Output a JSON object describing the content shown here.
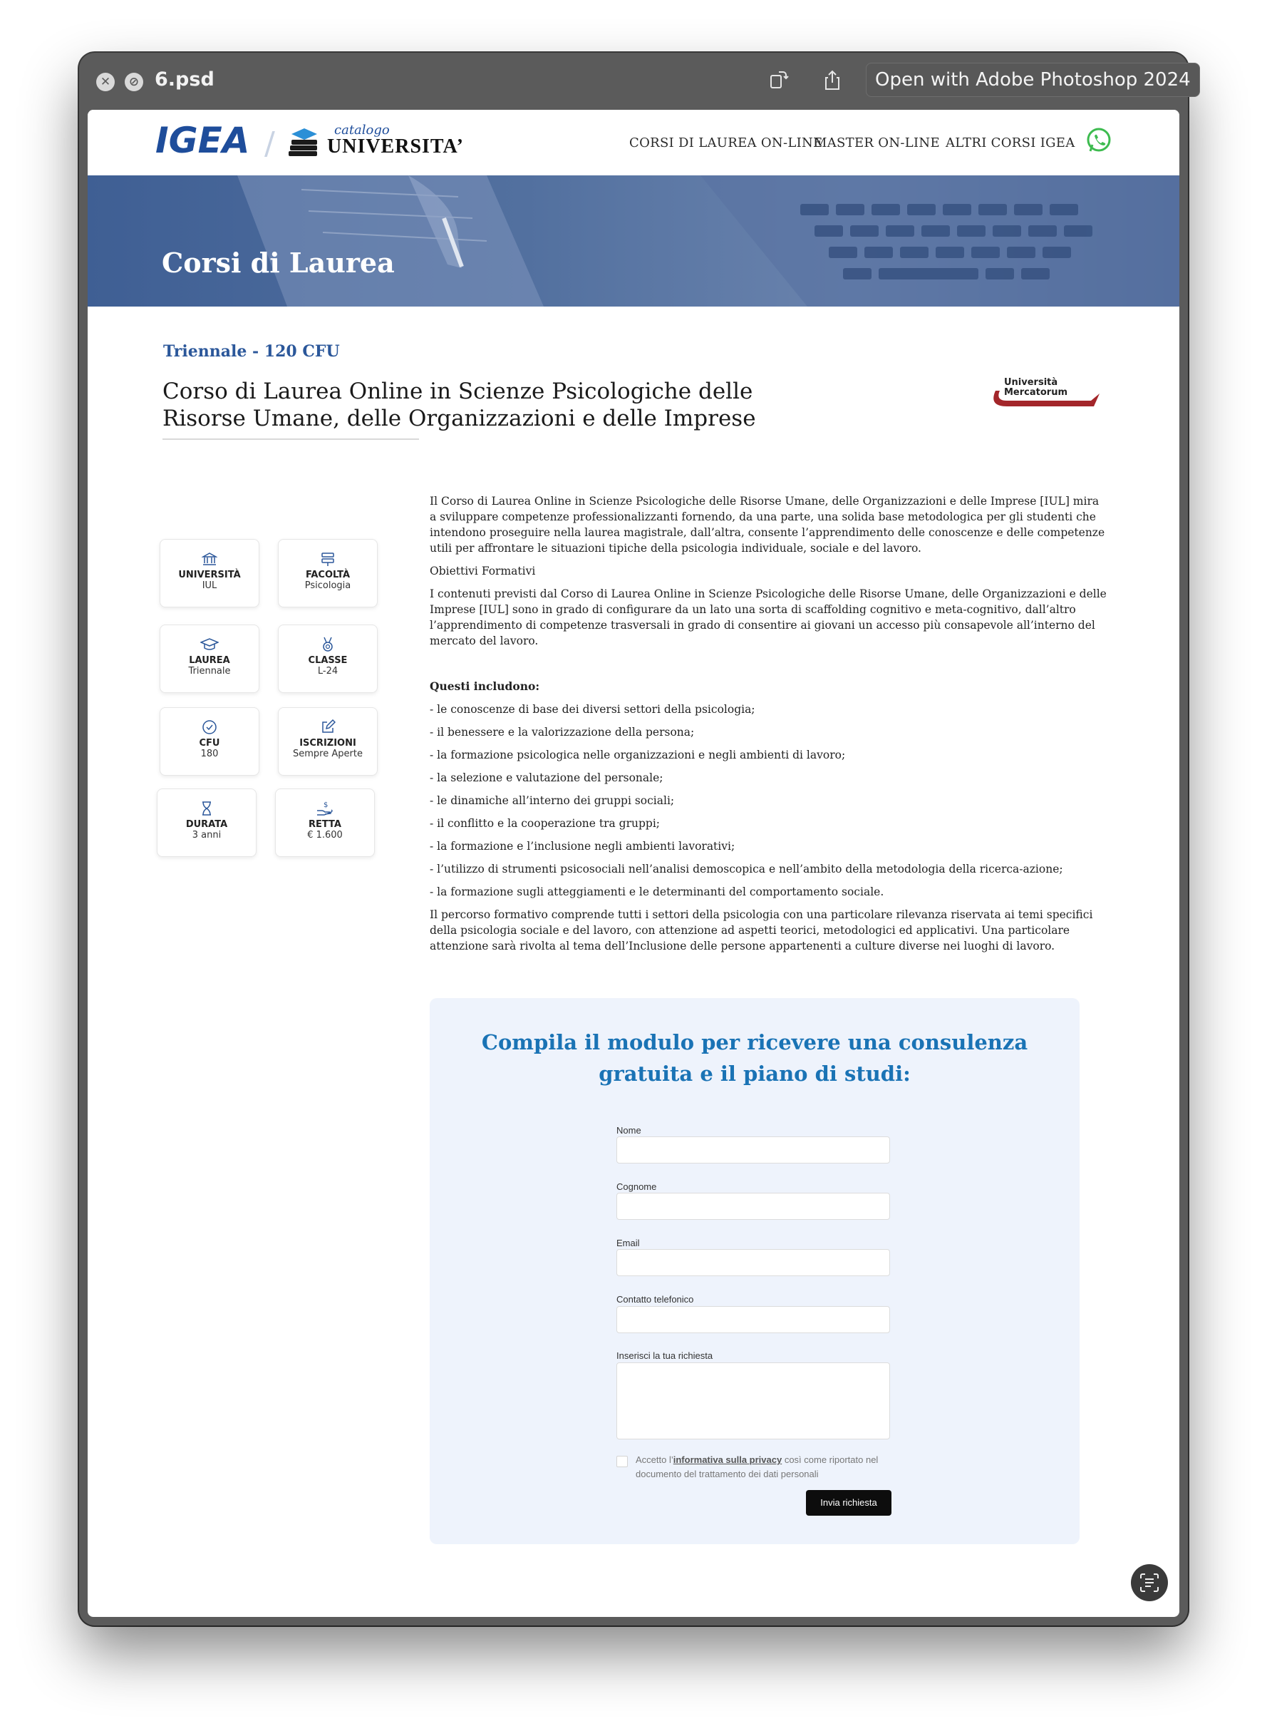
{
  "window": {
    "title": "6.psd",
    "open_with_label": "Open with Adobe Photoshop 2024",
    "close_icon": "close-icon",
    "block_icon": "block-icon",
    "rotate_icon": "rotate-icon",
    "share_icon": "share-icon"
  },
  "header": {
    "logo_text": "IGEA",
    "logo_catalogo": "catalogo",
    "logo_universita": "UNIVERSITA’",
    "nav": [
      "CORSI DI LAUREA ON-LINE",
      "MASTER ON-LINE",
      "ALTRI CORSI IGEA"
    ],
    "whatsapp_icon": "whatsapp-icon"
  },
  "hero": {
    "title": "Corsi di Laurea"
  },
  "course": {
    "tag": "Triennale - 120 CFU",
    "title": "Corso di Laurea Online in Scienze Psicologiche delle Risorse Umane, delle Organizzazioni e delle Imprese",
    "university_logo_text_1": "Università",
    "university_logo_text_2": "Mercatorum"
  },
  "cards": [
    {
      "label": "UNIVERSITÀ",
      "value": "IUL",
      "icon": "university-icon"
    },
    {
      "label": "FACOLTÀ",
      "value": "Psicologia",
      "icon": "signpost-icon"
    },
    {
      "label": "LAUREA",
      "value": "Triennale",
      "icon": "graduation-cap-icon"
    },
    {
      "label": "CLASSE",
      "value": "L-24",
      "icon": "medal-icon"
    },
    {
      "label": "CFU",
      "value": "180",
      "icon": "check-circle-icon"
    },
    {
      "label": "ISCRIZIONI",
      "value": "Sempre Aperte",
      "icon": "edit-icon"
    },
    {
      "label": "DURATA",
      "value": "3 anni",
      "icon": "hourglass-icon"
    },
    {
      "label": "RETTA",
      "value": "€ 1.600",
      "icon": "money-hand-icon"
    }
  ],
  "description": {
    "intro": "Il Corso di Laurea Online in Scienze Psicologiche delle Risorse Umane, delle Organizzazioni e delle Imprese [IUL] mira a sviluppare competenze professionalizzanti fornendo, da una parte, una solida base metodologica per gli studenti che intendono proseguire nella laurea magistrale, dall’altra, consente l’apprendimento delle conoscenze e delle competenze utili per affrontare le situazioni tipiche della psicologia individuale, sociale e del lavoro.",
    "objectives_title": "Obiettivi Formativi",
    "objectives": "I contenuti previsti dal Corso di Laurea Online in Scienze Psicologiche delle Risorse Umane, delle Organizzazioni e delle Imprese [IUL] sono in grado di configurare da un lato una sorta di scaffolding cognitivo e meta-cognitivo, dall’altro l’apprendimento di competenze trasversali in grado di consentire ai giovani un accesso più consapevole all’interno del mercato del lavoro.",
    "includes_title": "Questi includono:",
    "includes": [
      "- le conoscenze di base dei diversi settori della psicologia;",
      "- il benessere e la valorizzazione della persona;",
      "- la formazione psicologica nelle organizzazioni e negli ambienti di lavoro;",
      "- la selezione e valutazione del personale;",
      "- le dinamiche all’interno dei gruppi sociali;",
      "- il conflitto e la cooperazione tra gruppi;",
      "- la formazione e l’inclusione negli ambienti lavorativi;",
      "- l’utilizzo di strumenti psicosociali nell’analisi demoscopica e nell’ambito della metodologia della ricerca-azione;",
      "- la formazione sugli atteggiamenti e le determinanti del comportamento sociale."
    ],
    "closing": "Il percorso formativo comprende tutti i settori della psicologia con una particolare rilevanza riservata ai temi specifici della psicologia sociale e del lavoro, con attenzione ad aspetti teorici, metodologici ed applicativi. Una particolare attenzione sarà rivolta al tema dell’Inclusione delle persone appartenenti a culture diverse nei luoghi di lavoro."
  },
  "form": {
    "title_line1": "Compila il modulo per ricevere una consulenza",
    "title_line2": "gratuita e il piano di studi:",
    "fields": [
      {
        "label": "Nome",
        "value": ""
      },
      {
        "label": "Cognome",
        "value": ""
      },
      {
        "label": "Email",
        "value": ""
      },
      {
        "label": "Contatto telefonico",
        "value": ""
      }
    ],
    "request_label": "Inserisci la tua richiesta",
    "privacy_prefix": "Accetto l’",
    "privacy_link": "informativa sulla privacy",
    "privacy_suffix": " così come riportato nel documento del trattamento dei dati personali",
    "submit_label": "Invia richiesta"
  },
  "colors": {
    "brand_blue": "#1e4d9b",
    "form_title": "#1a73b5",
    "form_bg": "#eef3fc",
    "hero": "#4a6696",
    "mercatorum_red": "#a3262a",
    "whatsapp": "#3dbb4f"
  }
}
